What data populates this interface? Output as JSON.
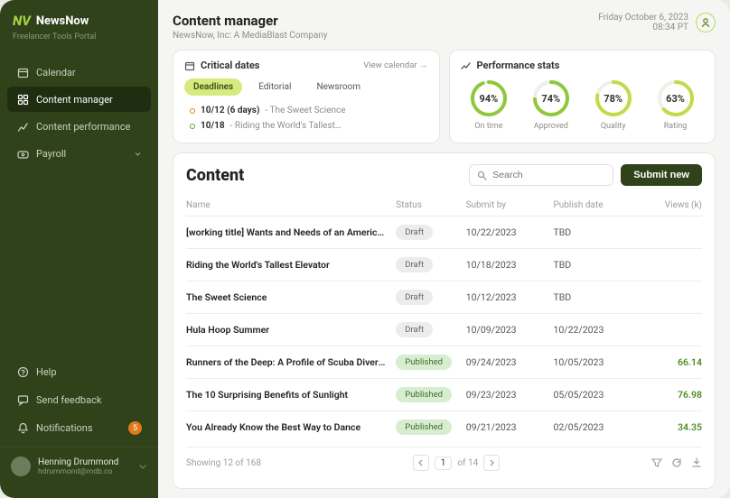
{
  "brand": {
    "logo": "NV",
    "name": "NewsNow",
    "subtitle": "Freelancer Tools Portal"
  },
  "nav": [
    {
      "label": "Calendar",
      "icon": "calendar-icon"
    },
    {
      "label": "Content manager",
      "icon": "grid-icon"
    },
    {
      "label": "Content performance",
      "icon": "chart-icon"
    },
    {
      "label": "Payroll",
      "icon": "money-icon",
      "chevron": true
    }
  ],
  "nav_active_index": 1,
  "bottom_nav": [
    {
      "label": "Help",
      "icon": "help-icon"
    },
    {
      "label": "Send feedback",
      "icon": "feedback-icon"
    },
    {
      "label": "Notifications",
      "icon": "bell-icon",
      "badge": "5"
    }
  ],
  "user": {
    "name": "Henning Drummond",
    "email": "hdrummond@mdb.co"
  },
  "header": {
    "title": "Content manager",
    "subtitle": "NewsNow, Inc: A MediaBlast Company",
    "date": "Friday October 6, 2023",
    "time": "08:34 PT"
  },
  "critical": {
    "title": "Critical dates",
    "view_link": "View calendar →",
    "tabs": [
      "Deadlines",
      "Editorial",
      "Newsroom"
    ],
    "active_tab": 0,
    "items": [
      {
        "date": "10/12 (6 days)",
        "title": "The Sweet Science",
        "color": "orange"
      },
      {
        "date": "10/18",
        "title": "Riding the World's Tallest…",
        "color": "green"
      }
    ]
  },
  "stats": {
    "title": "Performance stats",
    "items": [
      {
        "value": 94,
        "label": "On time",
        "color": "#8fc93a"
      },
      {
        "value": 74,
        "label": "Approved",
        "color": "#8fc93a"
      },
      {
        "value": 78,
        "label": "Quality",
        "color": "#c3da4a"
      },
      {
        "value": 63,
        "label": "Rating",
        "color": "#c3da4a"
      }
    ]
  },
  "content": {
    "heading": "Content",
    "search_placeholder": "Search",
    "submit_label": "Submit new",
    "columns": [
      "Name",
      "Status",
      "Submit by",
      "Publish date",
      "Views (k)"
    ],
    "rows": [
      {
        "name": "[working title] Wants and Needs of an America…",
        "status": "Draft",
        "submit": "10/22/2023",
        "publish": "TBD",
        "views": ""
      },
      {
        "name": "Riding the World's Tallest Elevator",
        "status": "Draft",
        "submit": "10/18/2023",
        "publish": "TBD",
        "views": ""
      },
      {
        "name": "The Sweet Science",
        "status": "Draft",
        "submit": "10/12/2023",
        "publish": "TBD",
        "views": ""
      },
      {
        "name": "Hula Hoop Summer",
        "status": "Draft",
        "submit": "10/09/2023",
        "publish": "10/22/2023",
        "views": ""
      },
      {
        "name": "Runners of the Deep: A Profile of Scuba Divers…",
        "status": "Published",
        "submit": "09/24/2023",
        "publish": "10/05/2023",
        "views": "66.14"
      },
      {
        "name": "The 10 Surprising Benefits of Sunlight",
        "status": "Published",
        "submit": "09/23/2023",
        "publish": "05/05/2023",
        "views": "76.98"
      },
      {
        "name": "You Already Know the Best Way to Dance",
        "status": "Published",
        "submit": "09/21/2023",
        "publish": "02/05/2023",
        "views": "34.35"
      }
    ],
    "footer": {
      "showing": "Showing 12 of 168",
      "page": "1",
      "of": "of 14"
    }
  }
}
